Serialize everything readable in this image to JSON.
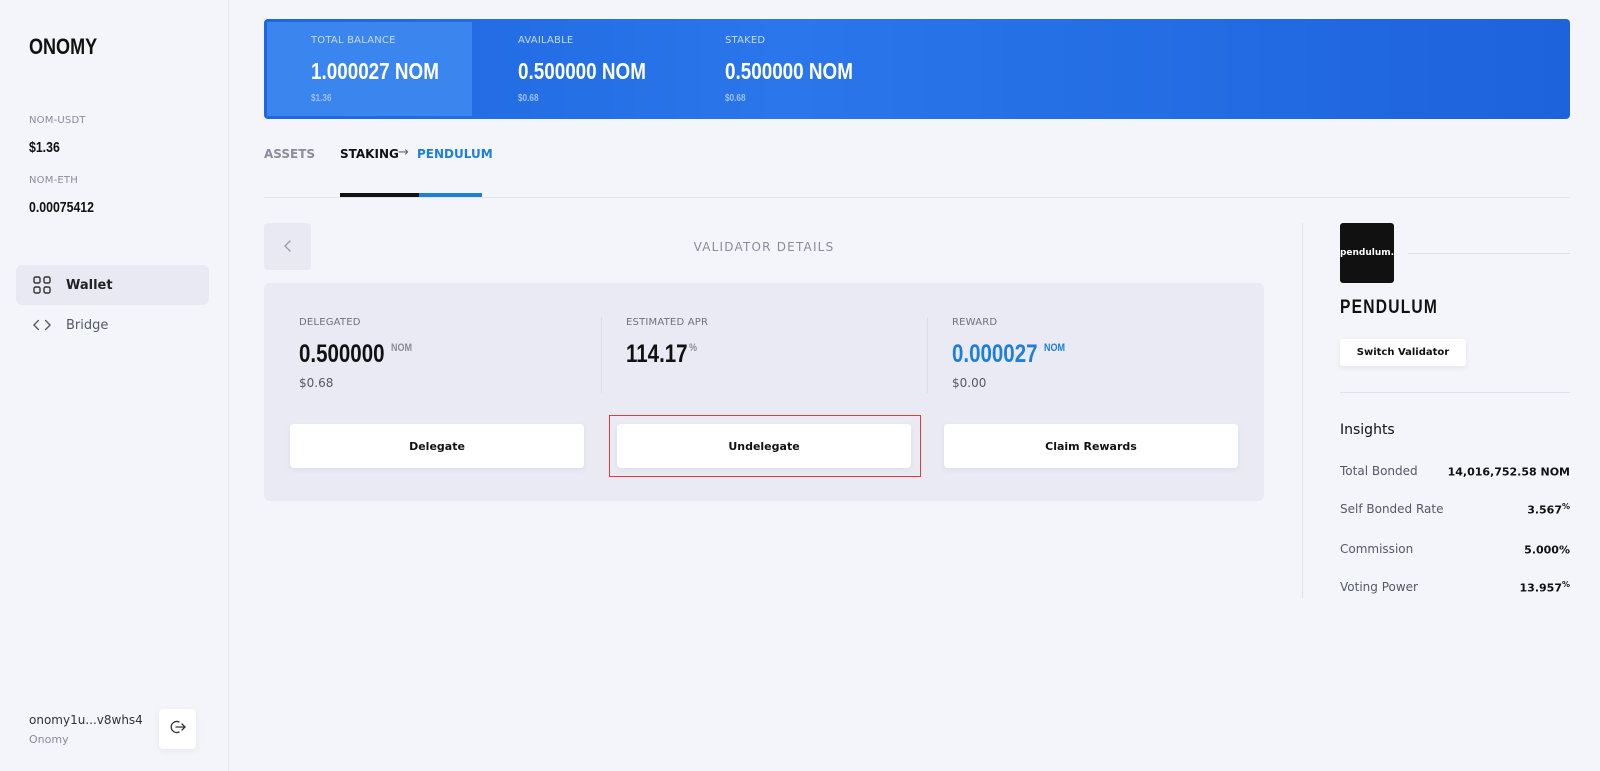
{
  "sidebar": {
    "logo": "ONOMY",
    "prices": [
      {
        "label": "NOM-USDT",
        "value": "$1.36"
      },
      {
        "label": "NOM-ETH",
        "value": "0.00075412"
      }
    ],
    "nav": [
      {
        "label": "Wallet",
        "icon": "grid-icon",
        "active": true
      },
      {
        "label": "Bridge",
        "icon": "code-brackets-icon",
        "active": false
      }
    ],
    "account": {
      "address": "onomy1u...v8whs4",
      "network": "Onomy"
    }
  },
  "banner": {
    "cells": [
      {
        "label": "TOTAL BALANCE",
        "value": "1.000027 NOM",
        "usd": "$1.36"
      },
      {
        "label": "AVAILABLE",
        "value": "0.500000 NOM",
        "usd": "$0.68"
      },
      {
        "label": "STAKED",
        "value": "0.500000 NOM",
        "usd": "$0.68"
      }
    ]
  },
  "tabs": {
    "assets": "ASSETS",
    "staking": "STAKING",
    "arrow": "→",
    "pendulum": "PENDULUM"
  },
  "validator_details": {
    "title": "VALIDATOR DETAILS",
    "stats": [
      {
        "label": "DELEGATED",
        "value": "0.500000",
        "unit": "NOM",
        "usd": "$0.68"
      },
      {
        "label": "ESTIMATED APR",
        "value": "114.17",
        "unit": "%",
        "usd": ""
      },
      {
        "label": "REWARD",
        "value": "0.000027",
        "unit": "NOM",
        "usd": "$0.00"
      }
    ],
    "buttons": {
      "delegate": "Delegate",
      "undelegate": "Undelegate",
      "claim": "Claim Rewards"
    }
  },
  "validator": {
    "logo_text": "pendulum.",
    "name": "PENDULUM",
    "switch_label": "Switch Validator",
    "insights_title": "Insights",
    "insights": [
      {
        "label": "Total Bonded",
        "value": "14,016,752.58 NOM",
        "suffix": ""
      },
      {
        "label": "Self Bonded Rate",
        "value": "3.567",
        "suffix": "%"
      },
      {
        "label": "Commission",
        "value": "5.000%",
        "suffix": ""
      },
      {
        "label": "Voting Power",
        "value": "13.957",
        "suffix": "%"
      }
    ]
  },
  "colors": {
    "accent_blue": "#1e7fd8",
    "banner_blue": "#1f66e0",
    "highlight_red": "#e53935"
  }
}
